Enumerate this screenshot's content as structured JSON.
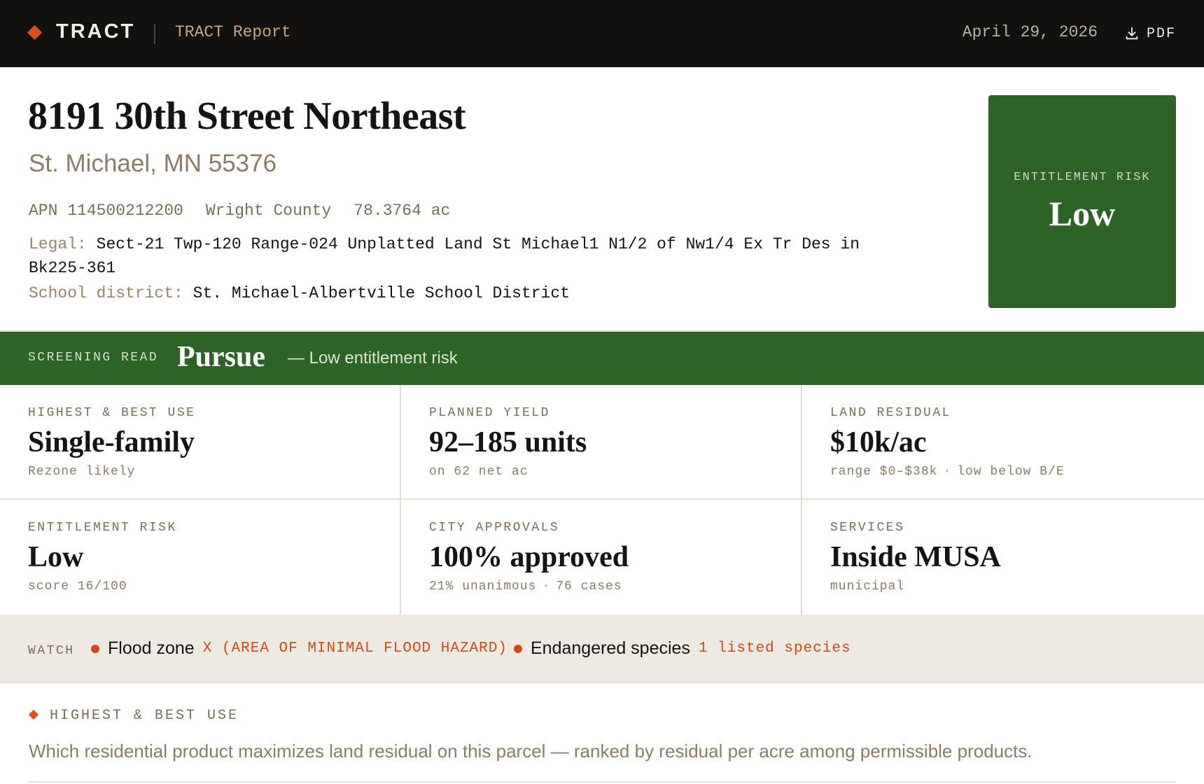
{
  "topbar": {
    "logo": "TRACT",
    "report_title": "TRACT Report",
    "date": "April 29, 2026",
    "pdf_label": "PDF",
    "colors": {
      "background": "#121110",
      "accent": "#d8501c"
    }
  },
  "header": {
    "address": "8191 30th Street Northeast",
    "city_line": "St. Michael, MN 55376",
    "apn": "APN 114500212200",
    "county": "Wright County",
    "acres": "78.3764 ac",
    "legal_label": "Legal:",
    "legal_value": "Sect-21 Twp-120 Range-024 Unplatted Land St Michael1 N1/2 of Nw1/4 Ex Tr Des in Bk225-361",
    "school_label": "School district:",
    "school_value": "St. Michael-Albertville School District"
  },
  "risk_card": {
    "label": "ENTITLEMENT RISK",
    "value": "Low",
    "color": "#2d6327"
  },
  "screening": {
    "label": "SCREENING READ",
    "value": "Pursue",
    "note": "— Low entitlement risk"
  },
  "metrics": [
    {
      "label": "HIGHEST & BEST USE",
      "value": "Single-family",
      "sub": [
        "Rezone likely"
      ]
    },
    {
      "label": "PLANNED YIELD",
      "value": "92–185 units",
      "sub": [
        "on 62 net ac"
      ]
    },
    {
      "label": "LAND RESIDUAL",
      "value": "$10k/ac",
      "sub": [
        "range $0–$38k",
        "low below B/E"
      ]
    },
    {
      "label": "ENTITLEMENT RISK",
      "value": "Low",
      "sub": [
        "score 16/100"
      ]
    },
    {
      "label": "CITY APPROVALS",
      "value": "100% approved",
      "sub": [
        "21% unanimous",
        "76 cases"
      ]
    },
    {
      "label": "SERVICES",
      "value": "Inside MUSA",
      "sub": [
        "municipal"
      ]
    }
  ],
  "watch": {
    "label": "WATCH",
    "items": [
      {
        "name": "Flood zone",
        "detail": "X (AREA OF MINIMAL FLOOD HAZARD)"
      },
      {
        "name": "Endangered species",
        "detail": "1 listed species"
      }
    ],
    "alert_color": "#cf4b16"
  },
  "section": {
    "title": "HIGHEST & BEST USE",
    "description": "Which residential product maximizes land residual on this parcel — ranked by residual per acre among permissible products."
  },
  "icons": {
    "pdf": "download-icon",
    "logo": "diamond-icon"
  }
}
